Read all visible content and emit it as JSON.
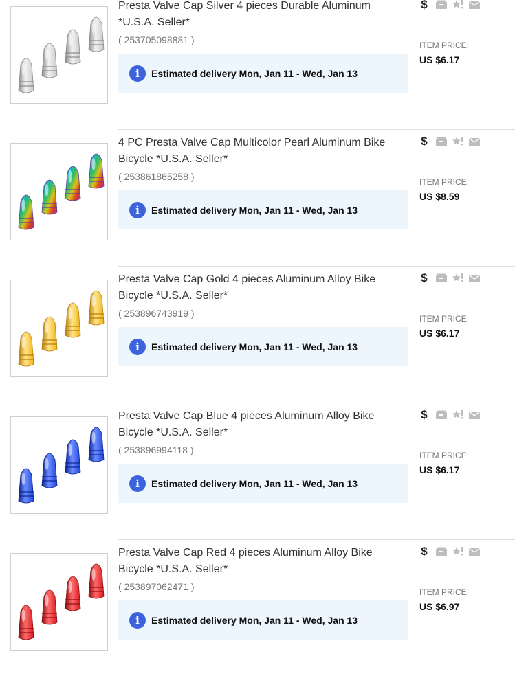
{
  "orders": [
    {
      "title": "Presta Valve Cap Silver 4 pieces Durable Aluminum *U.S.A. Seller*",
      "item_id": "( 253705098881 )",
      "delivery": "Estimated delivery Mon, Jan 11 - Wed, Jan 13",
      "price_label": "ITEM PRICE:",
      "price": "US $6.17",
      "color": "#c8c8c8",
      "color_dark": "#8a8a8a",
      "color_light": "#f2f2f2"
    },
    {
      "title": "4 PC Presta Valve Cap Multicolor Pearl Aluminum Bike Bicycle *U.S.A. Seller*",
      "item_id": "( 253861865258 )",
      "delivery": "Estimated delivery Mon, Jan 11 - Wed, Jan 13",
      "price_label": "ITEM PRICE:",
      "price": "US $8.59",
      "color": "rainbow",
      "color_dark": "#5a3a9a",
      "color_light": "#f0e090"
    },
    {
      "title": "Presta Valve Cap Gold 4 pieces Aluminum Alloy Bike Bicycle *U.S.A. Seller*",
      "item_id": "( 253896743919 )",
      "delivery": "Estimated delivery Mon, Jan 11 - Wed, Jan 13",
      "price_label": "ITEM PRICE:",
      "price": "US $6.17",
      "color": "#f1b417",
      "color_dark": "#b67c05",
      "color_light": "#ffe48a"
    },
    {
      "title": "Presta Valve Cap Blue 4 pieces Aluminum Alloy Bike Bicycle *U.S.A. Seller*",
      "item_id": "( 253896994118 )",
      "delivery": "Estimated delivery Mon, Jan 11 - Wed, Jan 13",
      "price_label": "ITEM PRICE:",
      "price": "US $6.17",
      "color": "#1f45d6",
      "color_dark": "#0b2391",
      "color_light": "#6b8cff"
    },
    {
      "title": "Presta Valve Cap Red 4 pieces Aluminum Alloy Bike Bicycle *U.S.A. Seller*",
      "item_id": "( 253897062471 )",
      "delivery": "Estimated delivery Mon, Jan 11 - Wed, Jan 13",
      "price_label": "ITEM PRICE:",
      "price": "US $6.97",
      "color": "#d51a20",
      "color_dark": "#8c0b10",
      "color_light": "#ff6a6a"
    }
  ],
  "status_icons": [
    "dollar-paid-icon",
    "shipped-box-icon",
    "feedback-star-icon",
    "message-envelope-icon"
  ],
  "info_icon_glyph": "i",
  "dollar_glyph": "$"
}
